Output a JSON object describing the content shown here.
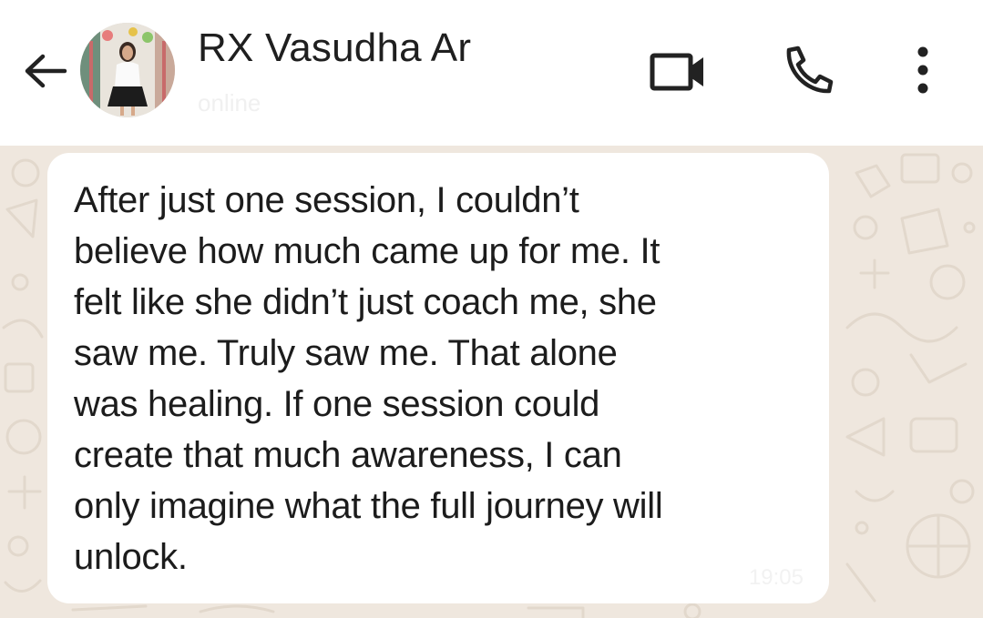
{
  "header": {
    "contact_name": "RX Vasudha Ar",
    "contact_status": "online",
    "back_icon": "arrow-left-icon",
    "video_icon": "video-camera-icon",
    "call_icon": "phone-icon",
    "menu_icon": "more-vertical-icon"
  },
  "message": {
    "text": "After just one session, I couldn’t\nbelieve how much came up for me. It\nfelt like she didn’t just coach me, she\nsaw me. Truly saw me. That alone\nwas healing. If one session could\ncreate that much awareness, I can\nonly imagine what the full journey will\nunlock.",
    "time": "19:05"
  },
  "colors": {
    "header_bg": "#ffffff",
    "chat_bg": "#efe7de",
    "bubble_bg": "#ffffff",
    "text": "#1c1c1c",
    "doodle": "#e2d8cc"
  }
}
